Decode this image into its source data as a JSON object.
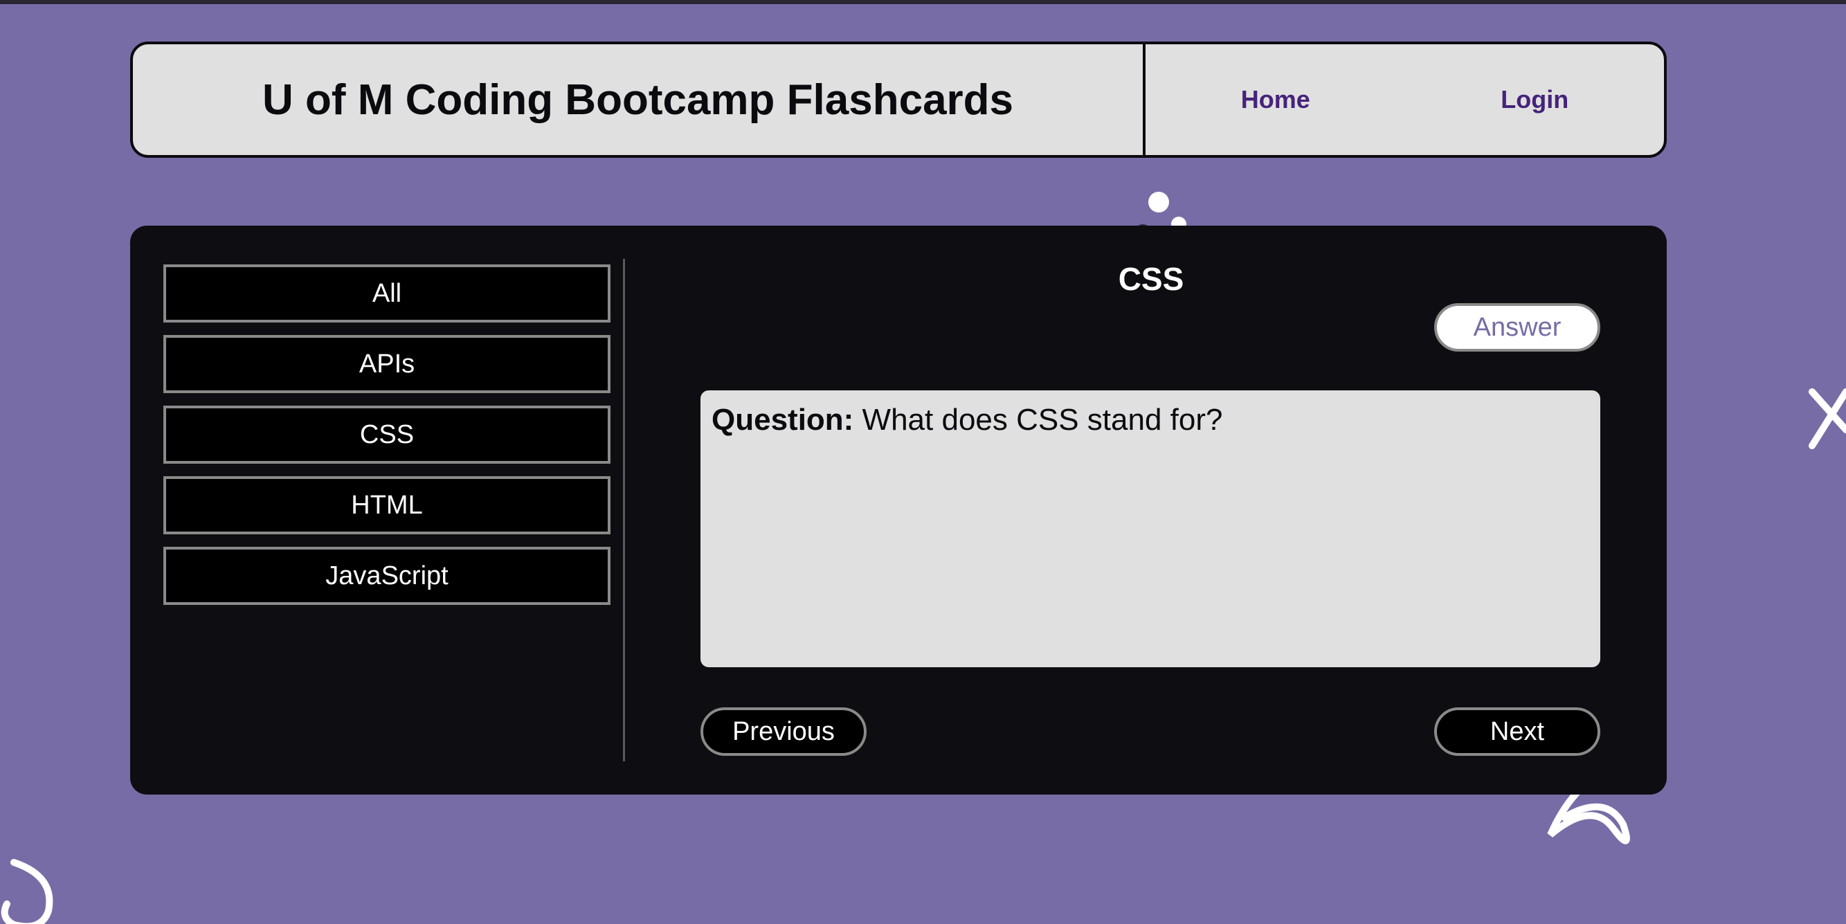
{
  "header": {
    "title": "U of M Coding Bootcamp Flashcards",
    "nav": [
      {
        "label": "Home"
      },
      {
        "label": "Login"
      }
    ]
  },
  "sidebar": {
    "categories": [
      {
        "label": "All"
      },
      {
        "label": "APIs"
      },
      {
        "label": "CSS"
      },
      {
        "label": "HTML"
      },
      {
        "label": "JavaScript"
      }
    ]
  },
  "card": {
    "category": "CSS",
    "answer_label": "Answer",
    "question_label": "Question:",
    "question_text": " What does CSS stand for?",
    "previous_label": "Previous",
    "next_label": "Next"
  },
  "colors": {
    "background": "#786ca6",
    "panel": "#0e0e12",
    "card": "#e0e0e0",
    "nav_link": "#46237a",
    "answer_text": "#786ca6"
  }
}
